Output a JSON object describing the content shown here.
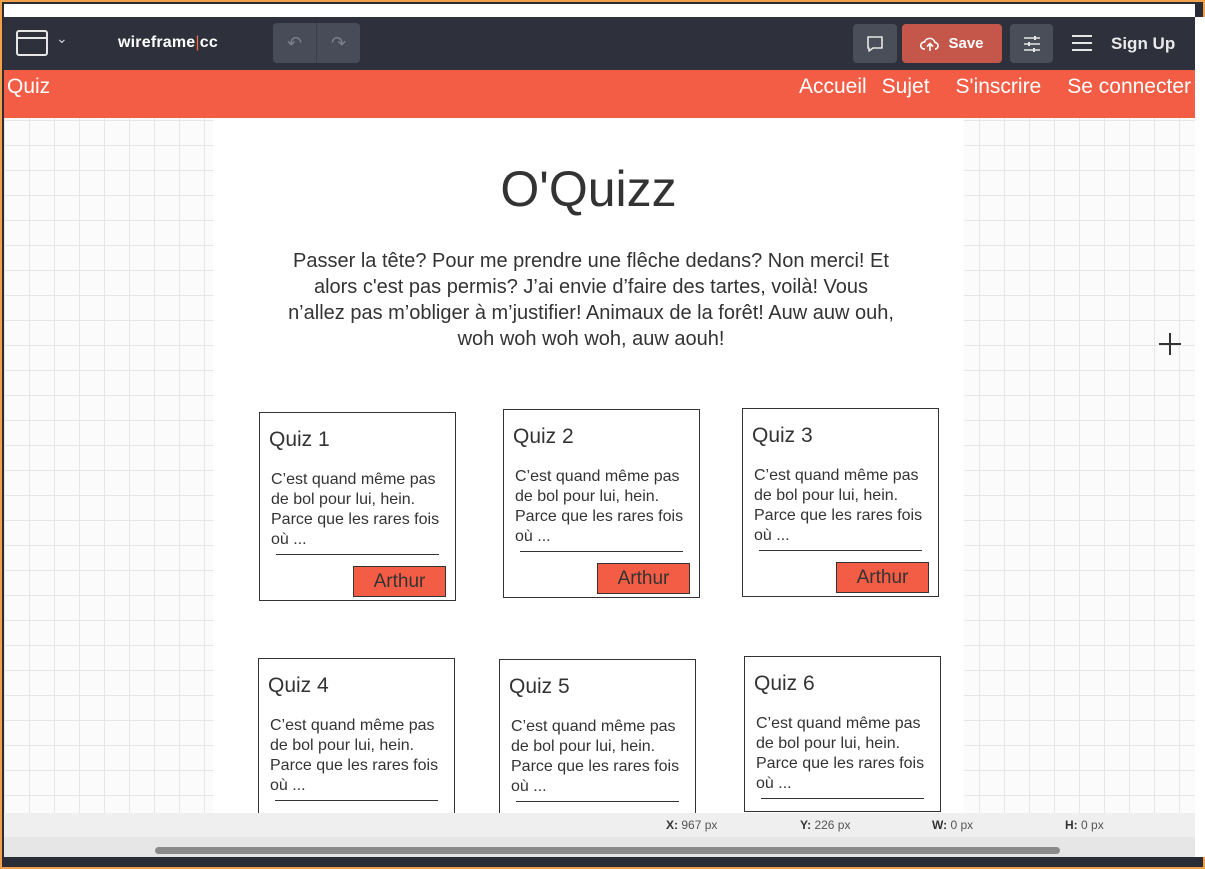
{
  "toolbar": {
    "logo_part1": "wireframe",
    "logo_sep": "|",
    "logo_part2": "cc",
    "undo_icon": "↶",
    "redo_icon": "↷",
    "save_label": "Save",
    "signup_label": "Sign Up"
  },
  "site": {
    "brand": "Quiz",
    "nav": [
      "Accueil",
      "Sujet",
      "S'inscrire",
      "Se connecter"
    ],
    "title": "O'Quizz",
    "intro": "Passer la tête? Pour me prendre une flêche dedans? Non merci! Et alors c'est pas permis? J’ai envie d’faire des tartes, voilà! Vous n’allez pas m’obliger à m’justifier! Animaux de la forêt! Auw auw ouh, woh woh woh woh, auw aouh!"
  },
  "cards": [
    {
      "title": "Quiz 1",
      "text": "C’est quand même pas de bol pour lui, hein. Parce que les rares fois où ...",
      "button": "Arthur"
    },
    {
      "title": "Quiz 2",
      "text": "C’est quand même pas de bol pour lui, hein. Parce que les rares fois où ...",
      "button": "Arthur"
    },
    {
      "title": "Quiz 3",
      "text": "C’est quand même pas de bol pour lui, hein. Parce que les rares fois où ...",
      "button": "Arthur"
    },
    {
      "title": "Quiz 4",
      "text": "C’est quand même pas de bol pour lui, hein. Parce que les rares fois où ..."
    },
    {
      "title": "Quiz 5",
      "text": "C’est quand même pas de bol pour lui, hein. Parce que les rares fois où ..."
    },
    {
      "title": "Quiz 6",
      "text": "C’est quand même pas de bol pour lui, hein. Parce que les rares fois où ..."
    }
  ],
  "status": {
    "x_label": "X:",
    "x_value": "967 px",
    "y_label": "Y:",
    "y_value": "226 px",
    "w_label": "W:",
    "w_value": "0 px",
    "h_label": "H:",
    "h_value": "0 px"
  },
  "colors": {
    "accent": "#f45d45",
    "save": "#c4574a",
    "toolbar": "#2e313b"
  }
}
